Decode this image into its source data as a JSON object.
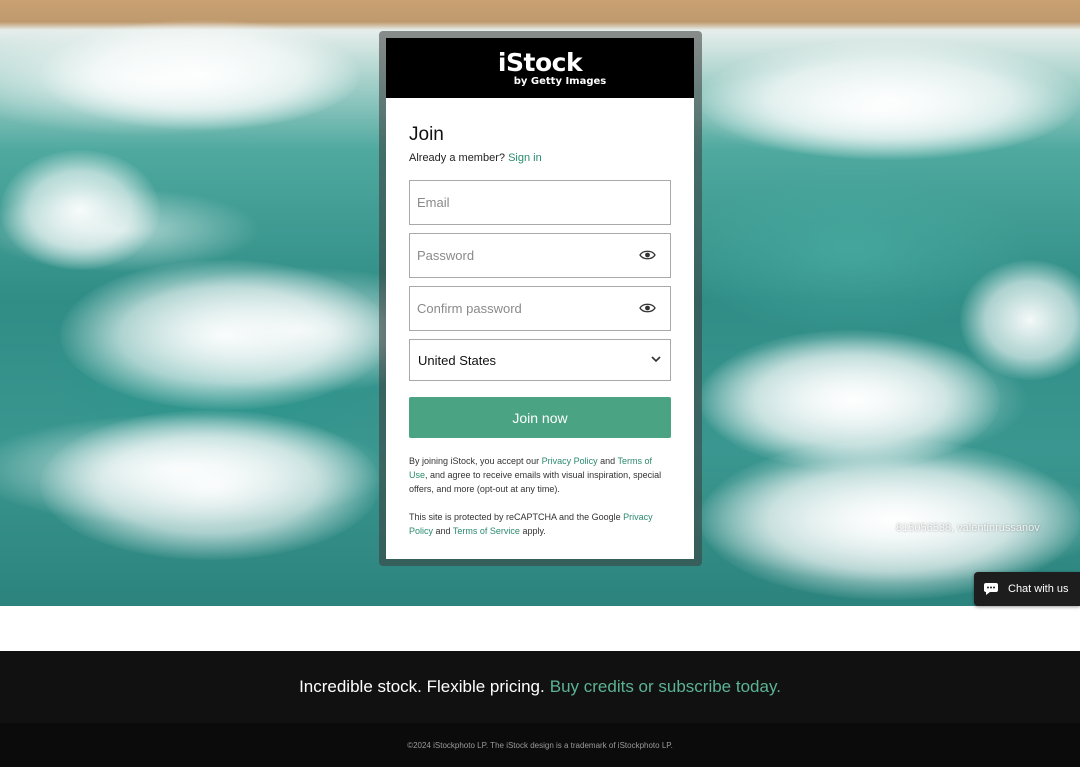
{
  "brand": {
    "logo_main": "iStock",
    "logo_sub": "by Getty Images"
  },
  "form": {
    "title": "Join",
    "member_prompt": "Already a member?",
    "sign_in_link": "Sign in",
    "email_placeholder": "Email",
    "password_placeholder": "Password",
    "confirm_password_placeholder": "Confirm password",
    "country_selected": "United States",
    "submit_label": "Join now"
  },
  "legal": {
    "part1": "By joining iStock, you accept our",
    "privacy_link": "Privacy Policy",
    "part2": "and",
    "terms_link": "Terms of Use",
    "part3": ", and agree to receive emails with visual inspiration, special offers, and more (opt-out at any time)."
  },
  "recaptcha": {
    "part1": "This site is protected by reCAPTCHA and the Google",
    "privacy_link": "Privacy Policy",
    "part2": "and",
    "terms_link": "Terms of Service",
    "part3": "apply."
  },
  "photo_credit": "815056538, valentinrussanov",
  "chat": {
    "label": "Chat with us",
    "icon": "chat-bubble-icon"
  },
  "footer": {
    "promo_text": "Incredible stock. Flexible pricing.",
    "promo_link": "Buy credits or subscribe today.",
    "copyright": "©2024 iStockphoto LP. The iStock design is a trademark of iStockphoto LP."
  },
  "colors": {
    "accent": "#4aa383",
    "link": "#2b8a6e",
    "promo_link": "#5bb393",
    "header_bg": "#000000",
    "footer_bg": "#111111"
  }
}
